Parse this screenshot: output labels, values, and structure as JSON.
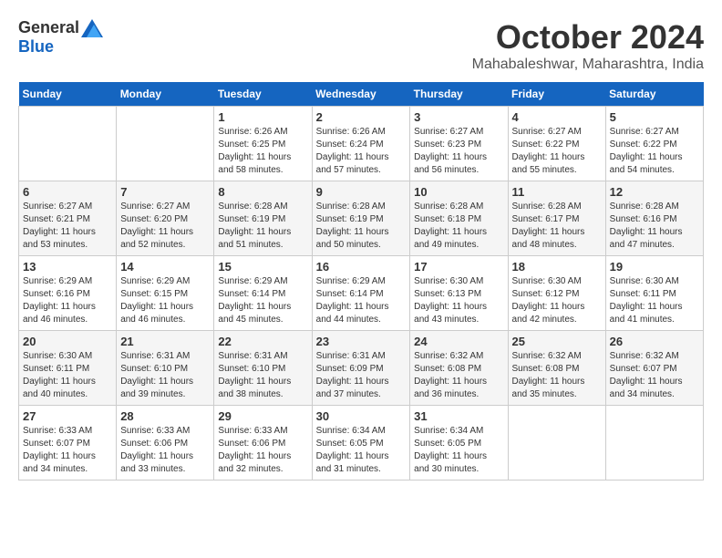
{
  "header": {
    "logo": {
      "general": "General",
      "blue": "Blue"
    },
    "title": "October 2024",
    "location": "Mahabaleshwar, Maharashtra, India"
  },
  "calendar": {
    "days_of_week": [
      "Sunday",
      "Monday",
      "Tuesday",
      "Wednesday",
      "Thursday",
      "Friday",
      "Saturday"
    ],
    "weeks": [
      [
        {
          "day": "",
          "sunrise": "",
          "sunset": "",
          "daylight": ""
        },
        {
          "day": "",
          "sunrise": "",
          "sunset": "",
          "daylight": ""
        },
        {
          "day": "1",
          "sunrise": "Sunrise: 6:26 AM",
          "sunset": "Sunset: 6:25 PM",
          "daylight": "Daylight: 11 hours and 58 minutes."
        },
        {
          "day": "2",
          "sunrise": "Sunrise: 6:26 AM",
          "sunset": "Sunset: 6:24 PM",
          "daylight": "Daylight: 11 hours and 57 minutes."
        },
        {
          "day": "3",
          "sunrise": "Sunrise: 6:27 AM",
          "sunset": "Sunset: 6:23 PM",
          "daylight": "Daylight: 11 hours and 56 minutes."
        },
        {
          "day": "4",
          "sunrise": "Sunrise: 6:27 AM",
          "sunset": "Sunset: 6:22 PM",
          "daylight": "Daylight: 11 hours and 55 minutes."
        },
        {
          "day": "5",
          "sunrise": "Sunrise: 6:27 AM",
          "sunset": "Sunset: 6:22 PM",
          "daylight": "Daylight: 11 hours and 54 minutes."
        }
      ],
      [
        {
          "day": "6",
          "sunrise": "Sunrise: 6:27 AM",
          "sunset": "Sunset: 6:21 PM",
          "daylight": "Daylight: 11 hours and 53 minutes."
        },
        {
          "day": "7",
          "sunrise": "Sunrise: 6:27 AM",
          "sunset": "Sunset: 6:20 PM",
          "daylight": "Daylight: 11 hours and 52 minutes."
        },
        {
          "day": "8",
          "sunrise": "Sunrise: 6:28 AM",
          "sunset": "Sunset: 6:19 PM",
          "daylight": "Daylight: 11 hours and 51 minutes."
        },
        {
          "day": "9",
          "sunrise": "Sunrise: 6:28 AM",
          "sunset": "Sunset: 6:19 PM",
          "daylight": "Daylight: 11 hours and 50 minutes."
        },
        {
          "day": "10",
          "sunrise": "Sunrise: 6:28 AM",
          "sunset": "Sunset: 6:18 PM",
          "daylight": "Daylight: 11 hours and 49 minutes."
        },
        {
          "day": "11",
          "sunrise": "Sunrise: 6:28 AM",
          "sunset": "Sunset: 6:17 PM",
          "daylight": "Daylight: 11 hours and 48 minutes."
        },
        {
          "day": "12",
          "sunrise": "Sunrise: 6:28 AM",
          "sunset": "Sunset: 6:16 PM",
          "daylight": "Daylight: 11 hours and 47 minutes."
        }
      ],
      [
        {
          "day": "13",
          "sunrise": "Sunrise: 6:29 AM",
          "sunset": "Sunset: 6:16 PM",
          "daylight": "Daylight: 11 hours and 46 minutes."
        },
        {
          "day": "14",
          "sunrise": "Sunrise: 6:29 AM",
          "sunset": "Sunset: 6:15 PM",
          "daylight": "Daylight: 11 hours and 46 minutes."
        },
        {
          "day": "15",
          "sunrise": "Sunrise: 6:29 AM",
          "sunset": "Sunset: 6:14 PM",
          "daylight": "Daylight: 11 hours and 45 minutes."
        },
        {
          "day": "16",
          "sunrise": "Sunrise: 6:29 AM",
          "sunset": "Sunset: 6:14 PM",
          "daylight": "Daylight: 11 hours and 44 minutes."
        },
        {
          "day": "17",
          "sunrise": "Sunrise: 6:30 AM",
          "sunset": "Sunset: 6:13 PM",
          "daylight": "Daylight: 11 hours and 43 minutes."
        },
        {
          "day": "18",
          "sunrise": "Sunrise: 6:30 AM",
          "sunset": "Sunset: 6:12 PM",
          "daylight": "Daylight: 11 hours and 42 minutes."
        },
        {
          "day": "19",
          "sunrise": "Sunrise: 6:30 AM",
          "sunset": "Sunset: 6:11 PM",
          "daylight": "Daylight: 11 hours and 41 minutes."
        }
      ],
      [
        {
          "day": "20",
          "sunrise": "Sunrise: 6:30 AM",
          "sunset": "Sunset: 6:11 PM",
          "daylight": "Daylight: 11 hours and 40 minutes."
        },
        {
          "day": "21",
          "sunrise": "Sunrise: 6:31 AM",
          "sunset": "Sunset: 6:10 PM",
          "daylight": "Daylight: 11 hours and 39 minutes."
        },
        {
          "day": "22",
          "sunrise": "Sunrise: 6:31 AM",
          "sunset": "Sunset: 6:10 PM",
          "daylight": "Daylight: 11 hours and 38 minutes."
        },
        {
          "day": "23",
          "sunrise": "Sunrise: 6:31 AM",
          "sunset": "Sunset: 6:09 PM",
          "daylight": "Daylight: 11 hours and 37 minutes."
        },
        {
          "day": "24",
          "sunrise": "Sunrise: 6:32 AM",
          "sunset": "Sunset: 6:08 PM",
          "daylight": "Daylight: 11 hours and 36 minutes."
        },
        {
          "day": "25",
          "sunrise": "Sunrise: 6:32 AM",
          "sunset": "Sunset: 6:08 PM",
          "daylight": "Daylight: 11 hours and 35 minutes."
        },
        {
          "day": "26",
          "sunrise": "Sunrise: 6:32 AM",
          "sunset": "Sunset: 6:07 PM",
          "daylight": "Daylight: 11 hours and 34 minutes."
        }
      ],
      [
        {
          "day": "27",
          "sunrise": "Sunrise: 6:33 AM",
          "sunset": "Sunset: 6:07 PM",
          "daylight": "Daylight: 11 hours and 34 minutes."
        },
        {
          "day": "28",
          "sunrise": "Sunrise: 6:33 AM",
          "sunset": "Sunset: 6:06 PM",
          "daylight": "Daylight: 11 hours and 33 minutes."
        },
        {
          "day": "29",
          "sunrise": "Sunrise: 6:33 AM",
          "sunset": "Sunset: 6:06 PM",
          "daylight": "Daylight: 11 hours and 32 minutes."
        },
        {
          "day": "30",
          "sunrise": "Sunrise: 6:34 AM",
          "sunset": "Sunset: 6:05 PM",
          "daylight": "Daylight: 11 hours and 31 minutes."
        },
        {
          "day": "31",
          "sunrise": "Sunrise: 6:34 AM",
          "sunset": "Sunset: 6:05 PM",
          "daylight": "Daylight: 11 hours and 30 minutes."
        },
        {
          "day": "",
          "sunrise": "",
          "sunset": "",
          "daylight": ""
        },
        {
          "day": "",
          "sunrise": "",
          "sunset": "",
          "daylight": ""
        }
      ]
    ]
  }
}
